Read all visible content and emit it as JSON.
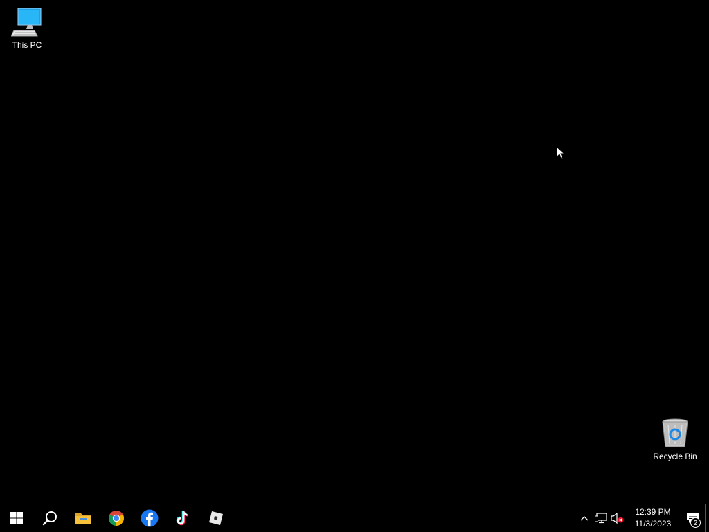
{
  "desktop": {
    "background_color": "#000000",
    "icons": [
      {
        "label": "This PC",
        "icon": "computer-icon"
      },
      {
        "label": "Recycle Bin",
        "icon": "recycle-bin-icon"
      }
    ]
  },
  "taskbar": {
    "background_color": "#000000",
    "pinned": [
      {
        "name": "Start",
        "icon": "windows-logo-icon"
      },
      {
        "name": "Search",
        "icon": "search-icon"
      },
      {
        "name": "File Explorer",
        "icon": "folder-icon"
      },
      {
        "name": "Google Chrome",
        "icon": "chrome-icon"
      },
      {
        "name": "Facebook",
        "icon": "facebook-icon"
      },
      {
        "name": "TikTok",
        "icon": "tiktok-icon"
      },
      {
        "name": "Roblox",
        "icon": "roblox-icon"
      }
    ],
    "tray": {
      "icons": [
        "chevron-up-icon",
        "network-icon",
        "volume-muted-icon"
      ],
      "time": "12:39 PM",
      "date": "11/3/2023",
      "notification_count": "2"
    }
  },
  "colors": {
    "accent_blue": "#1877f2",
    "folder_yellow": "#f5c13a"
  }
}
